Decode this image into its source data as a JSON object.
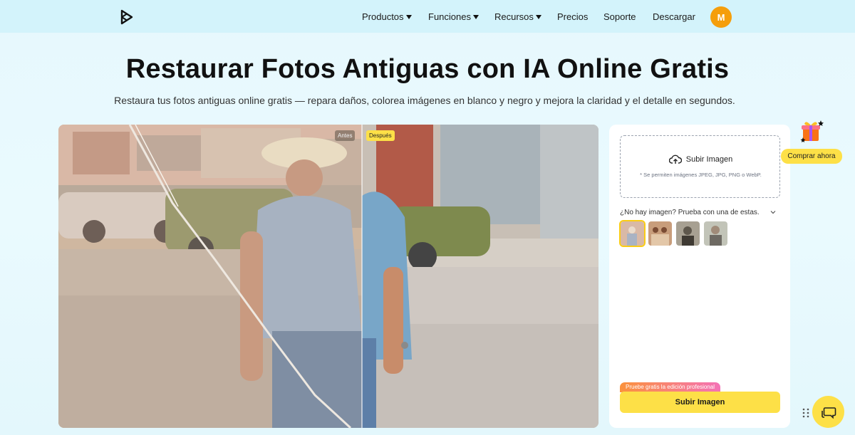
{
  "header": {
    "nav": [
      {
        "label": "Productos",
        "dropdown": true
      },
      {
        "label": "Funciones",
        "dropdown": true
      },
      {
        "label": "Recursos",
        "dropdown": true
      },
      {
        "label": "Precios",
        "dropdown": false
      },
      {
        "label": "Soporte",
        "dropdown": false
      },
      {
        "label": "Descargar",
        "dropdown": false
      }
    ],
    "avatar_initial": "M"
  },
  "hero": {
    "title": "Restaurar Fotos Antiguas con IA Online Gratis",
    "subtitle": "Restaura tus fotos antiguas online gratis — repara daños, colorea imágenes en blanco y negro y mejora la claridad y el detalle en segundos."
  },
  "compare": {
    "before_label": "Antes",
    "after_label": "Después"
  },
  "panel": {
    "upload_label": "Subir Imagen",
    "upload_note": "* Se permiten imágenes JPEG, JPG, PNG o WebP.",
    "samples_label": "¿No hay imagen? Prueba con una de estas.",
    "promo_label": "Pruebe gratis la edición profesional",
    "primary_button": "Subir Imagen"
  },
  "floating": {
    "buy_label": "Comprar ahora"
  },
  "colors": {
    "accent_yellow": "#fde047",
    "avatar_orange": "#f59e0b",
    "header_bg": "#d3f3fb"
  }
}
